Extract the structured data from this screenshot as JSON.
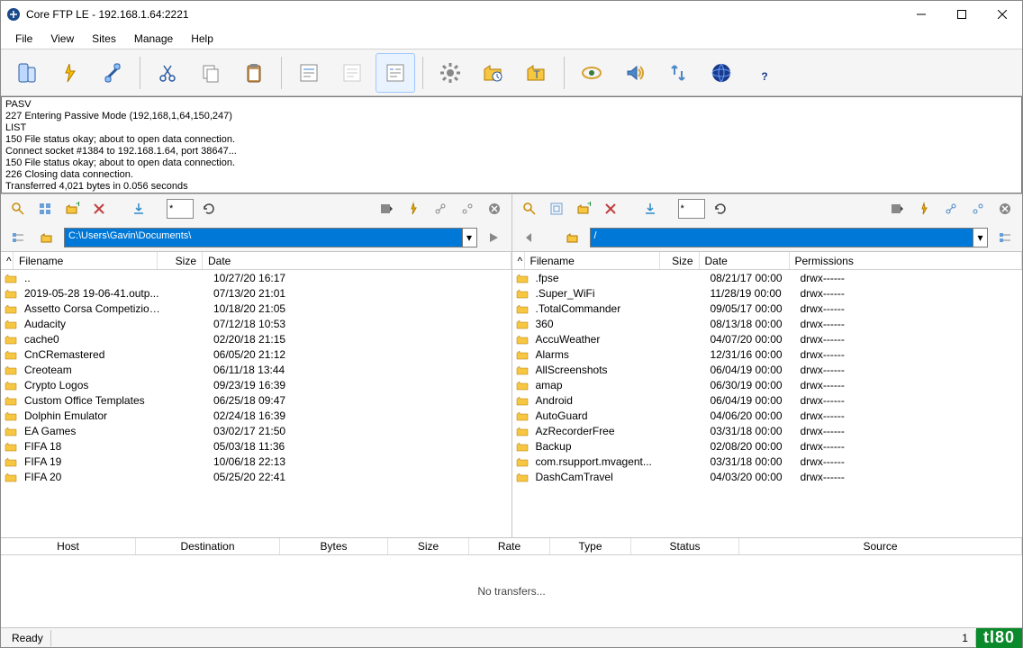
{
  "window": {
    "title": "Core FTP LE - 192.168.1.64:2221"
  },
  "menu": {
    "file": "File",
    "view": "View",
    "sites": "Sites",
    "manage": "Manage",
    "help": "Help"
  },
  "log": "PASV\n227 Entering Passive Mode (192,168,1,64,150,247)\nLIST\n150 File status okay; about to open data connection.\nConnect socket #1384 to 192.168.1.64, port 38647...\n150 File status okay; about to open data connection.\n226 Closing data connection.\nTransferred 4,021 bytes in 0.056 seconds",
  "left": {
    "filter": "*",
    "path": "C:\\Users\\Gavin\\Documents\\",
    "columns": {
      "name": "Filename",
      "size": "Size",
      "date": "Date"
    },
    "files": [
      {
        "name": "..",
        "size": "",
        "date": "10/27/20 16:17"
      },
      {
        "name": "2019-05-28 19-06-41.outp...",
        "size": "",
        "date": "07/13/20 21:01"
      },
      {
        "name": "Assetto Corsa Competizione",
        "size": "",
        "date": "10/18/20 21:05"
      },
      {
        "name": "Audacity",
        "size": "",
        "date": "07/12/18 10:53"
      },
      {
        "name": "cache0",
        "size": "",
        "date": "02/20/18 21:15"
      },
      {
        "name": "CnCRemastered",
        "size": "",
        "date": "06/05/20 21:12"
      },
      {
        "name": "Creoteam",
        "size": "",
        "date": "06/11/18 13:44"
      },
      {
        "name": "Crypto Logos",
        "size": "",
        "date": "09/23/19 16:39"
      },
      {
        "name": "Custom Office Templates",
        "size": "",
        "date": "06/25/18 09:47"
      },
      {
        "name": "Dolphin Emulator",
        "size": "",
        "date": "02/24/18 16:39"
      },
      {
        "name": "EA Games",
        "size": "",
        "date": "03/02/17 21:50"
      },
      {
        "name": "FIFA 18",
        "size": "",
        "date": "05/03/18 11:36"
      },
      {
        "name": "FIFA 19",
        "size": "",
        "date": "10/06/18 22:13"
      },
      {
        "name": "FIFA 20",
        "size": "",
        "date": "05/25/20 22:41"
      }
    ]
  },
  "right": {
    "filter": "*",
    "path": "/",
    "columns": {
      "name": "Filename",
      "size": "Size",
      "date": "Date",
      "perm": "Permissions"
    },
    "files": [
      {
        "name": ".fpse",
        "size": "",
        "date": "08/21/17 00:00",
        "perm": "drwx------"
      },
      {
        "name": ".Super_WiFi",
        "size": "",
        "date": "11/28/19 00:00",
        "perm": "drwx------"
      },
      {
        "name": ".TotalCommander",
        "size": "",
        "date": "09/05/17 00:00",
        "perm": "drwx------"
      },
      {
        "name": "360",
        "size": "",
        "date": "08/13/18 00:00",
        "perm": "drwx------"
      },
      {
        "name": "AccuWeather",
        "size": "",
        "date": "04/07/20 00:00",
        "perm": "drwx------"
      },
      {
        "name": "Alarms",
        "size": "",
        "date": "12/31/16 00:00",
        "perm": "drwx------"
      },
      {
        "name": "AllScreenshots",
        "size": "",
        "date": "06/04/19 00:00",
        "perm": "drwx------"
      },
      {
        "name": "amap",
        "size": "",
        "date": "06/30/19 00:00",
        "perm": "drwx------"
      },
      {
        "name": "Android",
        "size": "",
        "date": "06/04/19 00:00",
        "perm": "drwx------"
      },
      {
        "name": "AutoGuard",
        "size": "",
        "date": "04/06/20 00:00",
        "perm": "drwx------"
      },
      {
        "name": "AzRecorderFree",
        "size": "",
        "date": "03/31/18 00:00",
        "perm": "drwx------"
      },
      {
        "name": "Backup",
        "size": "",
        "date": "02/08/20 00:00",
        "perm": "drwx------"
      },
      {
        "name": "com.rsupport.mvagent...",
        "size": "",
        "date": "03/31/18 00:00",
        "perm": "drwx------"
      },
      {
        "name": "DashCamTravel",
        "size": "",
        "date": "04/03/20 00:00",
        "perm": "drwx------"
      }
    ]
  },
  "transfer": {
    "columns": {
      "host": "Host",
      "dest": "Destination",
      "bytes": "Bytes",
      "size": "Size",
      "rate": "Rate",
      "type": "Type",
      "status": "Status",
      "source": "Source"
    },
    "empty": "No transfers..."
  },
  "status": {
    "ready": "Ready",
    "count": "1"
  },
  "brand": "tl80"
}
